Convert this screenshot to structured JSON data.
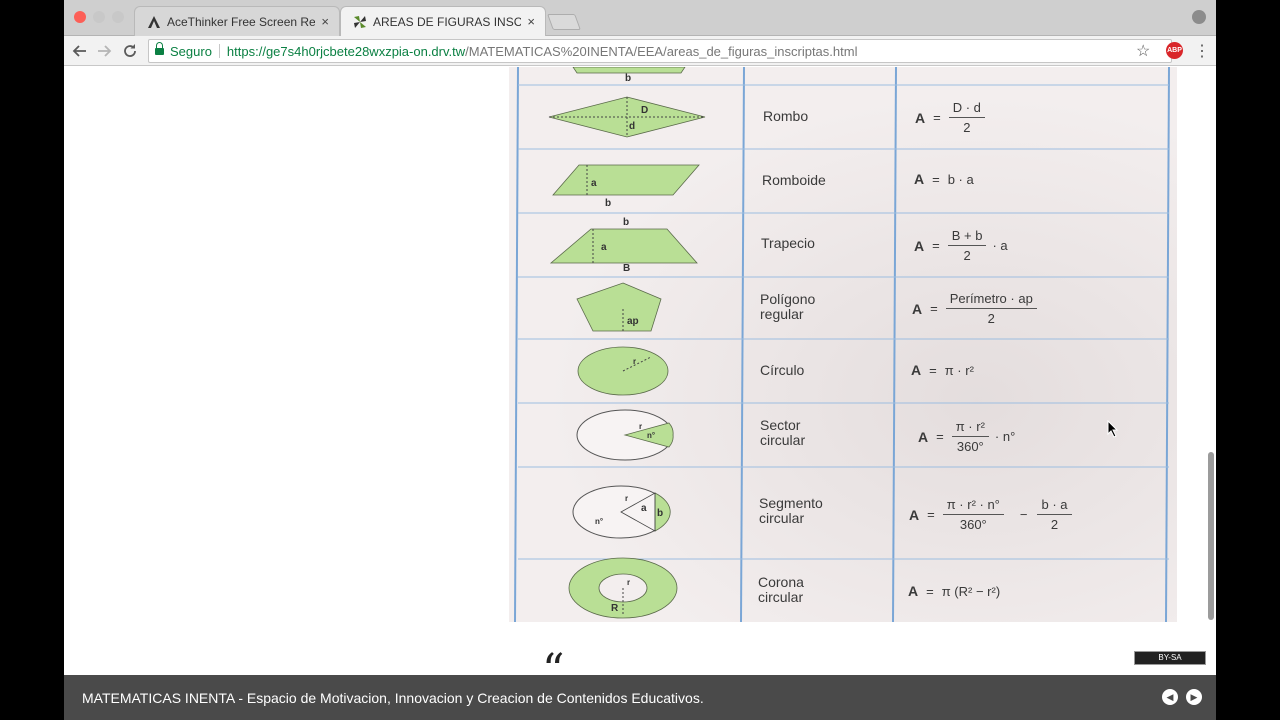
{
  "browser": {
    "tabs": [
      {
        "title": "AceThinker Free Screen Recor",
        "favicon": "acethinker-icon"
      },
      {
        "title": "AREAS DE FIGURAS INSCRIPTA",
        "favicon": "pinwheel-icon"
      }
    ],
    "tab_close": "×",
    "secure_label": "Seguro",
    "url_host": "https://ge7s4h0rjcbete28wxzpia-on.drv.tw",
    "url_path": "/MATEMATICAS%20INENTA/EEA/areas_de_figuras_inscriptas.html",
    "abp_label": "ABP"
  },
  "table": {
    "rows": [
      {
        "label": [
          "Rombo"
        ],
        "formula": {
          "lead": "A",
          "eq": "=",
          "num": "D · d",
          "den": "2"
        }
      },
      {
        "label": [
          "Romboide"
        ],
        "formula": {
          "lead": "A",
          "eq": "=",
          "text": "b · a"
        }
      },
      {
        "label": [
          "Trapecio"
        ],
        "formula": {
          "lead": "A",
          "eq": "=",
          "num": "B + b",
          "den": "2",
          "tail": "· a"
        }
      },
      {
        "label": [
          "Polígono",
          "regular"
        ],
        "formula": {
          "lead": "A",
          "eq": "=",
          "num": "Perímetro · ap",
          "den": "2"
        }
      },
      {
        "label": [
          "Círculo"
        ],
        "formula": {
          "lead": "A",
          "eq": "=",
          "text": "π · r²"
        }
      },
      {
        "label": [
          "Sector",
          "circular"
        ],
        "formula": {
          "lead": "A",
          "eq": "=",
          "num": "π · r²",
          "den": "360°",
          "tail": "· n°"
        }
      },
      {
        "label": [
          "Segmento",
          "circular"
        ],
        "formula": {
          "lead": "A",
          "eq": "=",
          "num": "π · r² · n°",
          "den": "360°",
          "mid": "−",
          "num2": "b · a",
          "den2": "2"
        }
      },
      {
        "label": [
          "Corona",
          "circular"
        ],
        "formula": {
          "lead": "A",
          "eq": "=",
          "text": "π (R² − r²)"
        }
      }
    ],
    "figure_labels": {
      "top_b": "b",
      "rombo_D": "D",
      "rombo_d": "d",
      "romboide_a": "a",
      "romboide_b": "b",
      "trapecio_b": "b",
      "trapecio_a": "a",
      "trapecio_B": "B",
      "poligono_ap": "ap",
      "circulo_r": "r",
      "sector_r": "r",
      "sector_n": "n°",
      "segmento_r": "r",
      "segmento_n": "n°",
      "segmento_a": "a",
      "segmento_b": "b",
      "corona_r": "r",
      "corona_R": "R"
    },
    "colors": {
      "fill": "#b9df95",
      "stroke": "#5a6a4a",
      "grid": "#7aa6d6"
    }
  },
  "page": {
    "quote_mark": "“",
    "license_badge": "BY-SA"
  },
  "footer": {
    "text": "MATEMATICAS INENTA - Espacio de Motivacion, Innovacion y Creacion de Contenidos Educativos.",
    "prev_icon": "chevron-left-icon",
    "next_icon": "chevron-right-icon"
  }
}
